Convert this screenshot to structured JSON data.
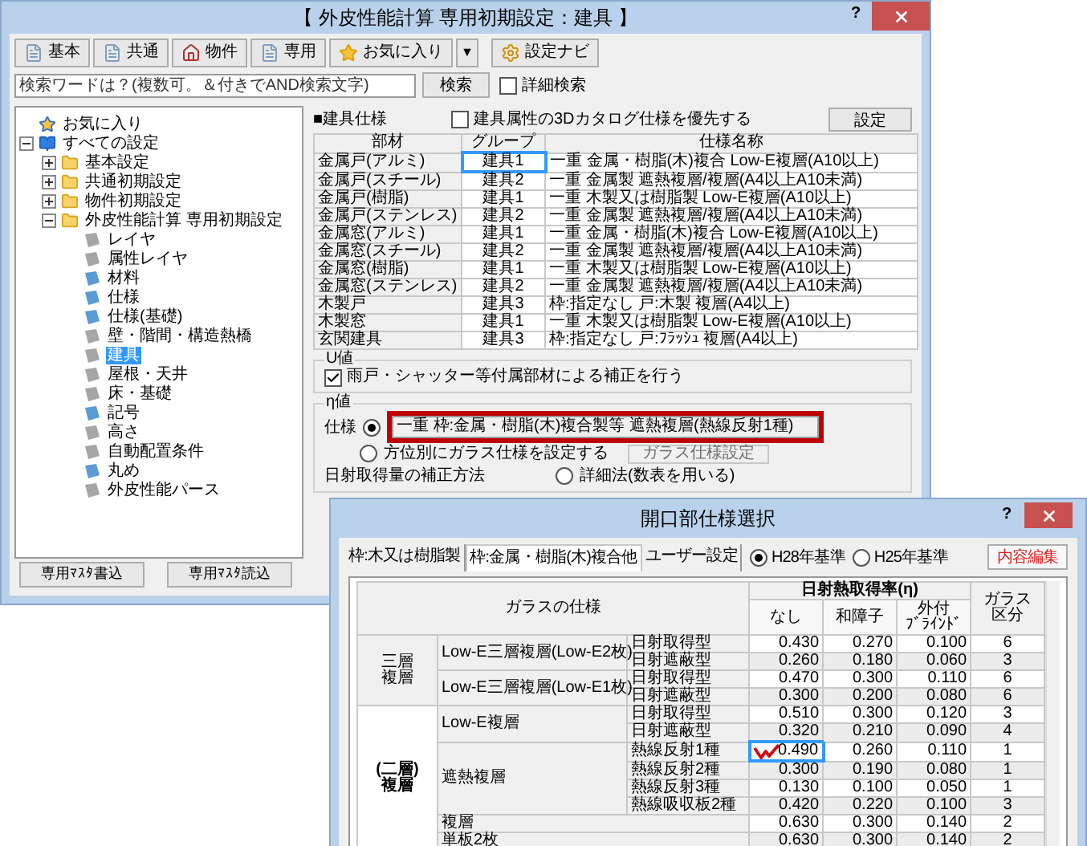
{
  "main_window": {
    "title": "【 外皮性能計算 専用初期設定：建具 】",
    "help": "?",
    "toolbar": [
      {
        "label": "基本",
        "kind": "page"
      },
      {
        "label": "共通",
        "kind": "page"
      },
      {
        "label": "物件",
        "kind": "house"
      },
      {
        "label": "専用",
        "kind": "page"
      },
      {
        "label": "お気に入り",
        "kind": "star"
      }
    ],
    "dropdown": "▼",
    "navi_button": "設定ナビ",
    "search": {
      "placeholder": "検索ワードは？(複数可。＆付きでAND検索文字)",
      "button": "検索",
      "detail": {
        "label": "詳細検索",
        "checked": false
      }
    },
    "tree": [
      {
        "label": "お気に入り",
        "kind": "favorite",
        "selected": false
      },
      {
        "label": "すべての設定",
        "kind": "book",
        "selected": false,
        "expanded": true,
        "children": [
          {
            "label": "基本設定",
            "kind": "folder",
            "selected": false,
            "expanded": false
          },
          {
            "label": "共通初期設定",
            "kind": "folder",
            "selected": false,
            "expanded": false
          },
          {
            "label": "物件初期設定",
            "kind": "folder",
            "selected": false,
            "expanded": false
          },
          {
            "label": "外皮性能計算 専用初期設定",
            "kind": "folder",
            "selected": false,
            "expanded": true,
            "children": [
              {
                "label": "レイヤ",
                "kind": "page",
                "selected": false,
                "color": "#a6a6a6"
              },
              {
                "label": "属性レイヤ",
                "kind": "page",
                "selected": false,
                "color": "#a6a6a6"
              },
              {
                "label": "材料",
                "kind": "page",
                "selected": false,
                "color": "#5b9bd5"
              },
              {
                "label": "仕様",
                "kind": "page",
                "selected": false,
                "color": "#5b9bd5"
              },
              {
                "label": "仕様(基礎)",
                "kind": "page",
                "selected": false,
                "color": "#5b9bd5"
              },
              {
                "label": "壁・階間・構造熱橋",
                "kind": "page",
                "selected": false,
                "color": "#a6a6a6"
              },
              {
                "label": "建具",
                "kind": "page",
                "selected": true,
                "color": "#a6a6a6"
              },
              {
                "label": "屋根・天井",
                "kind": "page",
                "selected": false,
                "color": "#a6a6a6"
              },
              {
                "label": "床・基礎",
                "kind": "page",
                "selected": false,
                "color": "#a6a6a6"
              },
              {
                "label": "記号",
                "kind": "page",
                "selected": false,
                "color": "#5b9bd5"
              },
              {
                "label": "高さ",
                "kind": "page",
                "selected": false,
                "color": "#a6a6a6"
              },
              {
                "label": "自動配置条件",
                "kind": "page",
                "selected": false,
                "color": "#a6a6a6"
              },
              {
                "label": "丸め",
                "kind": "page",
                "selected": false,
                "color": "#5b9bd5"
              },
              {
                "label": "外皮性能パース",
                "kind": "page",
                "selected": false,
                "color": "#a6a6a6"
              }
            ]
          }
        ]
      }
    ],
    "footer_buttons": [
      "専用ﾏｽﾀ書込",
      "専用ﾏｽﾀ読込"
    ],
    "spec": {
      "heading": "■建具仕様",
      "catalog": {
        "label": "建具属性の3Dカタログ仕様を優先する",
        "checked": false
      },
      "settings_button": "設定",
      "columns": [
        "部材",
        "グループ",
        "仕様名称"
      ],
      "rows": [
        {
          "part": "金属戸(アルミ)",
          "group": "建具1",
          "spec": "一重 金属・樹脂(木)複合 Low-E複層(A10以上)",
          "selected": true
        },
        {
          "part": "金属戸(スチール)",
          "group": "建具2",
          "spec": "一重 金属製 遮熱複層/複層(A4以上A10未満)",
          "selected": false
        },
        {
          "part": "金属戸(樹脂)",
          "group": "建具1",
          "spec": "一重 木製又は樹脂製 Low-E複層(A10以上)",
          "selected": false
        },
        {
          "part": "金属戸(ステンレス)",
          "group": "建具2",
          "spec": "一重 金属製 遮熱複層/複層(A4以上A10未満)",
          "selected": false
        },
        {
          "part": "金属窓(アルミ)",
          "group": "建具1",
          "spec": "一重 金属・樹脂(木)複合 Low-E複層(A10以上)",
          "selected": false
        },
        {
          "part": "金属窓(スチール)",
          "group": "建具2",
          "spec": "一重 金属製 遮熱複層/複層(A4以上A10未満)",
          "selected": false
        },
        {
          "part": "金属窓(樹脂)",
          "group": "建具1",
          "spec": "一重 木製又は樹脂製 Low-E複層(A10以上)",
          "selected": false
        },
        {
          "part": "金属窓(ステンレス)",
          "group": "建具2",
          "spec": "一重 金属製 遮熱複層/複層(A4以上A10未満)",
          "selected": false
        },
        {
          "part": "木製戸",
          "group": "建具3",
          "spec": "枠:指定なし 戸:木製 複層(A4以上)",
          "selected": false
        },
        {
          "part": "木製窓",
          "group": "建具1",
          "spec": "一重 木製又は樹脂製 Low-E複層(A10以上)",
          "selected": false
        },
        {
          "part": "玄関建具",
          "group": "建具3",
          "spec": "枠:指定なし 戸:ﾌﾗｯｼｭ 複層(A4以上)",
          "selected": false
        }
      ]
    },
    "u_value": {
      "legend": "U値",
      "correction": {
        "label": "雨戸・シャッター等付属部材による補正を行う",
        "checked": true
      }
    },
    "eta_value": {
      "legend": "η値",
      "spec_option": {
        "label": "仕様",
        "selected": true
      },
      "spec_field": {
        "value": "一重 枠:金属・樹脂(木)複合製等 遮熱複層(熱線反射1種)",
        "highlighted": true
      },
      "direction_option": {
        "label": "方位別にガラス仕様を設定する",
        "selected": false
      },
      "glass_button": {
        "label": "ガラス仕様設定",
        "disabled": true
      },
      "correction_label": "日射取得量の補正方法",
      "detail_option": {
        "label": "詳細法(数表を用いる)",
        "selected": false
      }
    }
  },
  "dialog": {
    "title": "開口部仕様選択",
    "help": "?",
    "tabs": [
      {
        "label": "枠:木又は樹脂製",
        "selected": false
      },
      {
        "label": "枠:金属・樹脂(木)複合他",
        "selected": true
      },
      {
        "label": "ユーザー設定",
        "selected": false
      }
    ],
    "standards": [
      {
        "label": "H28年基準",
        "selected": true
      },
      {
        "label": "H25年基準",
        "selected": false
      }
    ],
    "edit_button": "内容編集",
    "table": {
      "spec_header": "ガラスの仕様",
      "eta_header": "日射熱取得率(η)",
      "eta_columns": [
        [
          "なし"
        ],
        [
          "和障子"
        ],
        [
          "外付",
          "ﾌﾞﾗｲﾝﾄﾞ"
        ]
      ],
      "class_header": "ガラス区分",
      "groups": [
        {
          "label": "三層複層",
          "selected": false,
          "subgroups": [
            {
              "label": "Low-E三層複層(Low-E2枚)",
              "rows": [
                {
                  "type": "日射取得型",
                  "values": [
                    "0.430",
                    "0.270",
                    "0.100"
                  ],
                  "class": "6",
                  "selected": false,
                  "marked": false
                },
                {
                  "type": "日射遮蔽型",
                  "values": [
                    "0.260",
                    "0.180",
                    "0.060"
                  ],
                  "class": "3",
                  "selected": false,
                  "marked": false
                }
              ]
            },
            {
              "label": "Low-E三層複層(Low-E1枚)",
              "rows": [
                {
                  "type": "日射取得型",
                  "values": [
                    "0.470",
                    "0.300",
                    "0.110"
                  ],
                  "class": "6",
                  "selected": false,
                  "marked": false
                },
                {
                  "type": "日射遮蔽型",
                  "values": [
                    "0.300",
                    "0.200",
                    "0.080"
                  ],
                  "class": "6",
                  "selected": false,
                  "marked": false
                }
              ]
            }
          ]
        },
        {
          "label": "(二層)複層",
          "selected": true,
          "subgroups": [
            {
              "label": "Low-E複層",
              "rows": [
                {
                  "type": "日射取得型",
                  "values": [
                    "0.510",
                    "0.300",
                    "0.120"
                  ],
                  "class": "3",
                  "selected": false,
                  "marked": false
                },
                {
                  "type": "日射遮蔽型",
                  "values": [
                    "0.320",
                    "0.210",
                    "0.090"
                  ],
                  "class": "4",
                  "selected": false,
                  "marked": false
                }
              ]
            },
            {
              "label": "遮熱複層",
              "rows": [
                {
                  "type": "熱線反射1種",
                  "values": [
                    "0.490",
                    "0.260",
                    "0.110"
                  ],
                  "class": "1",
                  "selected": true,
                  "marked": true
                },
                {
                  "type": "熱線反射2種",
                  "values": [
                    "0.300",
                    "0.190",
                    "0.080"
                  ],
                  "class": "1",
                  "selected": false,
                  "marked": false
                },
                {
                  "type": "熱線反射3種",
                  "values": [
                    "0.130",
                    "0.100",
                    "0.050"
                  ],
                  "class": "1",
                  "selected": false,
                  "marked": false
                },
                {
                  "type": "熱線吸収板2種",
                  "values": [
                    "0.420",
                    "0.220",
                    "0.100"
                  ],
                  "class": "3",
                  "selected": false,
                  "marked": false
                }
              ]
            },
            {
              "label": "複層",
              "rows": [
                {
                  "values": [
                    "0.630",
                    "0.300",
                    "0.140"
                  ],
                  "class": "2",
                  "selected": false,
                  "marked": false
                }
              ]
            },
            {
              "label": "単板2枚",
              "rows": [
                {
                  "values": [
                    "0.630",
                    "0.300",
                    "0.140"
                  ],
                  "class": "2",
                  "selected": false,
                  "marked": false
                }
              ]
            }
          ]
        }
      ]
    }
  }
}
